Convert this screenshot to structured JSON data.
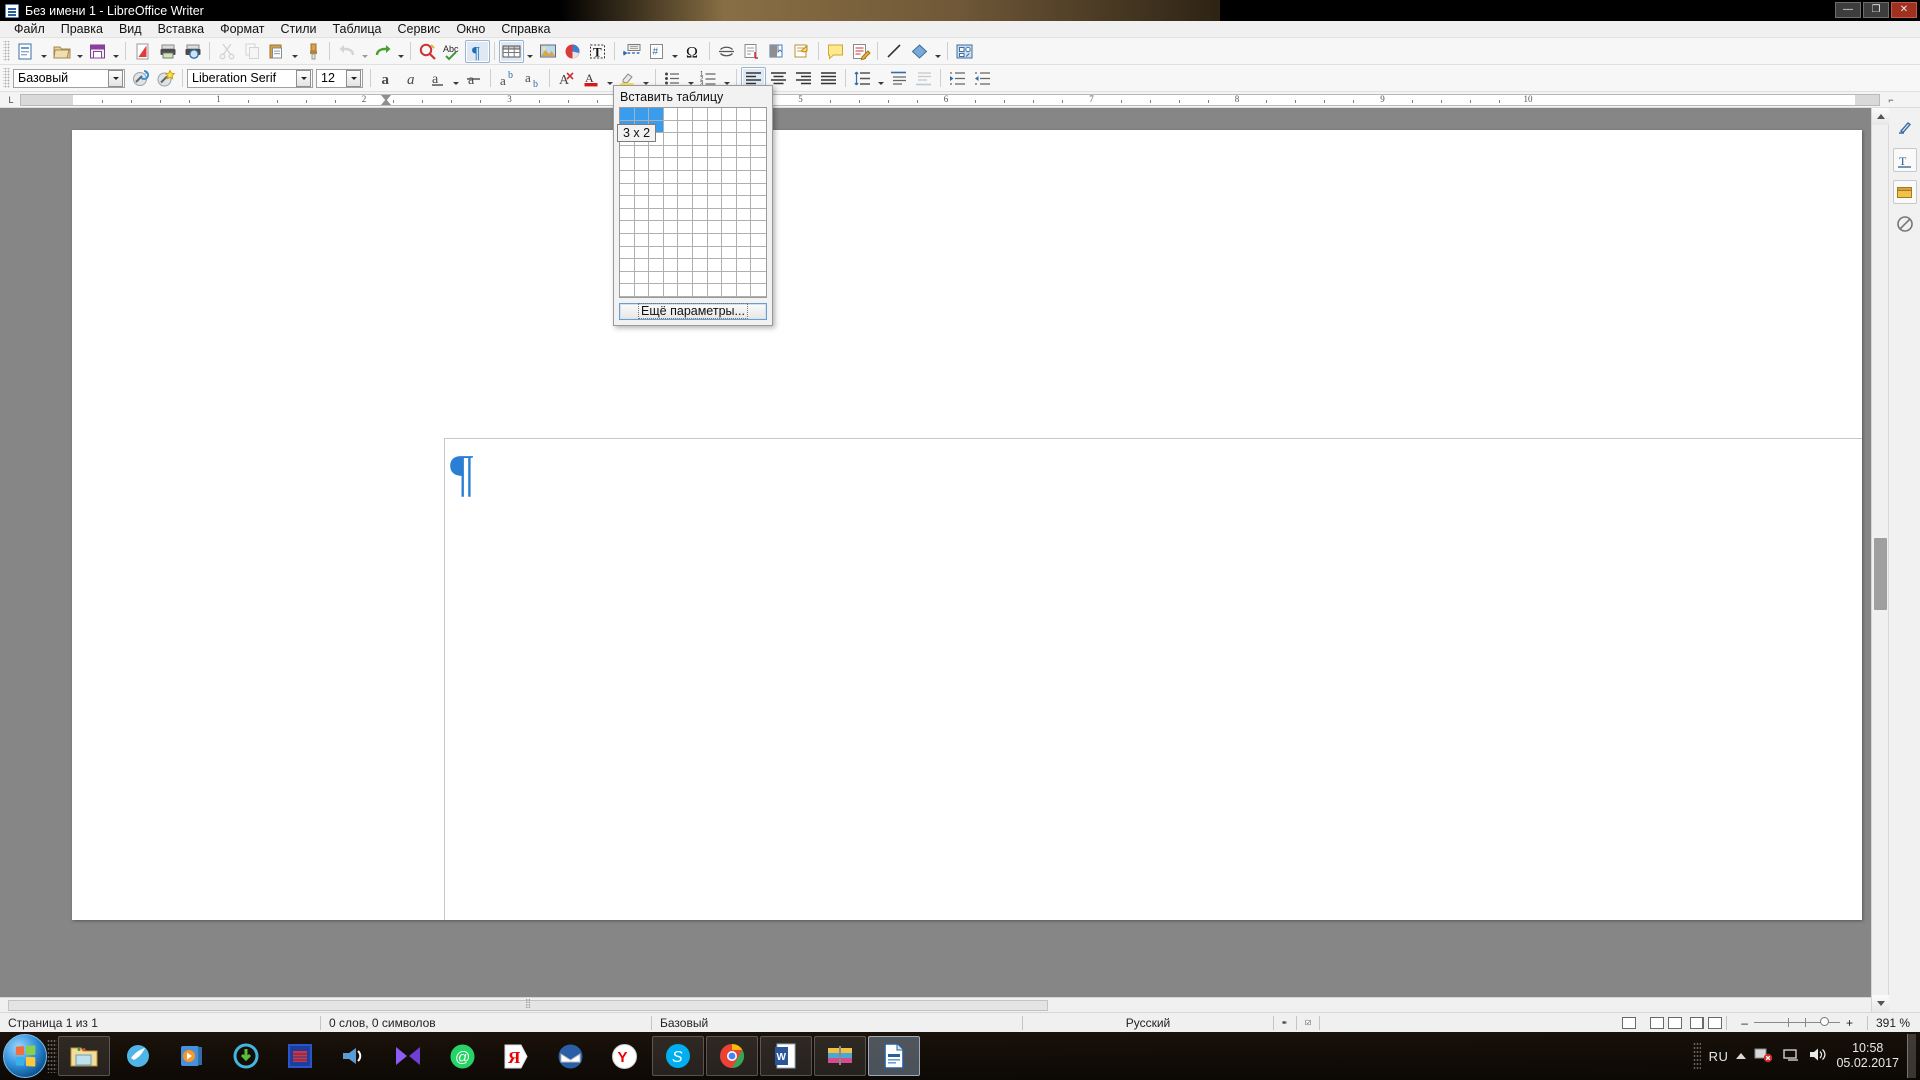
{
  "window": {
    "title": "Без имени 1 - LibreOffice Writer",
    "minimize_label": "—",
    "maximize_label": "❐",
    "close_label": "✕"
  },
  "menubar": {
    "items": [
      {
        "label": "Файл",
        "mnemonic": "Ф"
      },
      {
        "label": "Правка",
        "mnemonic": "П"
      },
      {
        "label": "Вид",
        "mnemonic": "В"
      },
      {
        "label": "Вставка",
        "mnemonic": "а"
      },
      {
        "label": "Формат",
        "mnemonic": "р"
      },
      {
        "label": "Стили",
        "mnemonic": ""
      },
      {
        "label": "Таблица",
        "mnemonic": "Т"
      },
      {
        "label": "Сервис",
        "mnemonic": "е"
      },
      {
        "label": "Окно",
        "mnemonic": "О"
      },
      {
        "label": "Справка",
        "mnemonic": "С"
      }
    ]
  },
  "toolbar_standard": {
    "buttons": [
      {
        "name": "new-document",
        "tooltip": "Создать"
      },
      {
        "name": "open-document",
        "tooltip": "Открыть"
      },
      {
        "name": "save-document",
        "tooltip": "Сохранить"
      },
      {
        "name": "export-pdf",
        "tooltip": "Экспорт в PDF"
      },
      {
        "name": "print",
        "tooltip": "Печать"
      },
      {
        "name": "print-preview",
        "tooltip": "Предварительный просмотр"
      },
      {
        "name": "cut",
        "tooltip": "Вырезать"
      },
      {
        "name": "copy",
        "tooltip": "Копировать"
      },
      {
        "name": "paste",
        "tooltip": "Вставить"
      },
      {
        "name": "clone-formatting",
        "tooltip": "Клонировать форматирование"
      },
      {
        "name": "undo",
        "tooltip": "Отменить"
      },
      {
        "name": "redo",
        "tooltip": "Вернуть"
      },
      {
        "name": "find-replace",
        "tooltip": "Найти и заменить"
      },
      {
        "name": "spelling",
        "tooltip": "Проверка орфографии"
      },
      {
        "name": "formatting-marks",
        "tooltip": "Непечатаемые символы"
      },
      {
        "name": "insert-table",
        "tooltip": "Вставить таблицу"
      },
      {
        "name": "insert-image",
        "tooltip": "Вставить изображение"
      },
      {
        "name": "insert-chart",
        "tooltip": "Вставить диаграмму"
      },
      {
        "name": "insert-text-box",
        "tooltip": "Вставить текстовое поле"
      },
      {
        "name": "insert-page-break",
        "tooltip": "Вставить разрыв страницы"
      },
      {
        "name": "insert-field",
        "tooltip": "Вставить поле"
      },
      {
        "name": "insert-special-character",
        "tooltip": "Вставить специальный символ"
      },
      {
        "name": "insert-footnote",
        "tooltip": "Вставить сноску"
      },
      {
        "name": "insert-endnote",
        "tooltip": "Вставить концевую сноску"
      },
      {
        "name": "insert-bookmark",
        "tooltip": "Вставить закладку"
      },
      {
        "name": "insert-cross-reference",
        "tooltip": "Перекрёстная ссылка"
      },
      {
        "name": "insert-comment",
        "tooltip": "Вставить комментарий"
      },
      {
        "name": "track-changes",
        "tooltip": "Запись изменений"
      },
      {
        "name": "insert-line",
        "tooltip": "Вставить линию"
      },
      {
        "name": "basic-shapes",
        "tooltip": "Основные фигуры"
      },
      {
        "name": "show-draw-functions",
        "tooltip": "Функции рисования"
      }
    ]
  },
  "toolbar_format": {
    "paragraph_style": "Базовый",
    "font_name": "Liberation Serif",
    "font_size": "12",
    "buttons": [
      {
        "name": "update-style",
        "tooltip": "Обновить стиль"
      },
      {
        "name": "new-style",
        "tooltip": "Создать стиль"
      },
      {
        "name": "bold",
        "tooltip": "Жирный"
      },
      {
        "name": "italic",
        "tooltip": "Курсив"
      },
      {
        "name": "underline",
        "tooltip": "Подчёркнутый"
      },
      {
        "name": "strikethrough",
        "tooltip": "Зачёркнутый"
      },
      {
        "name": "superscript",
        "tooltip": "Верхний индекс"
      },
      {
        "name": "subscript",
        "tooltip": "Нижний индекс"
      },
      {
        "name": "clear-formatting",
        "tooltip": "Очистить форматирование"
      },
      {
        "name": "font-color",
        "tooltip": "Цвет шрифта"
      },
      {
        "name": "highlighting-color",
        "tooltip": "Цвет выделения"
      },
      {
        "name": "bullet-list",
        "tooltip": "Маркированный список"
      },
      {
        "name": "number-list",
        "tooltip": "Нумерованный список"
      },
      {
        "name": "align-left",
        "tooltip": "По левому краю"
      },
      {
        "name": "align-center",
        "tooltip": "По центру"
      },
      {
        "name": "align-right",
        "tooltip": "По правому краю"
      },
      {
        "name": "align-justify",
        "tooltip": "По ширине"
      },
      {
        "name": "line-spacing",
        "tooltip": "Межстрочный интервал"
      },
      {
        "name": "paragraph-spacing-above",
        "tooltip": "Интервал сверху"
      },
      {
        "name": "paragraph-spacing-below",
        "tooltip": "Интервал снизу"
      },
      {
        "name": "increase-indent",
        "tooltip": "Увеличить отступ"
      },
      {
        "name": "decrease-indent",
        "tooltip": "Уменьшить отступ"
      }
    ]
  },
  "ruler": {
    "labels": [
      "1",
      "2",
      "3",
      "4",
      "5",
      "6",
      "7",
      "8",
      "9",
      "10"
    ],
    "left_marker": "L",
    "right_marker": "⌐"
  },
  "table_popup": {
    "title": "Вставить таблицу",
    "columns": 10,
    "rows": 15,
    "selected_columns": 3,
    "selected_rows": 2,
    "size_label": "3 x 2",
    "more_button": "Ещё параметры...",
    "more_button_underline": "Е",
    "selection_color": "#3a9cec"
  },
  "document": {
    "paragraph_mark": "¶",
    "paragraph_mark_color": "#2a7fd4"
  },
  "statusbar": {
    "page": "Страница 1 из 1",
    "words": "0 слов, 0 символов",
    "style": "Базовый",
    "language": "Русский",
    "selection_mode": "",
    "save_state": "",
    "zoom": "391 %",
    "zoom_out": "–",
    "zoom_in": "+",
    "view_single": "single-page-view",
    "view_multi": "multi-page-view",
    "view_book": "book-view"
  },
  "taskbar": {
    "start_label": "Пуск",
    "items": [
      {
        "name": "explorer",
        "label": "Проводник",
        "state": "pinned"
      },
      {
        "name": "maxthon-browser",
        "label": "Браузер",
        "state": "normal"
      },
      {
        "name": "media-player",
        "label": "Проигрыватель",
        "state": "normal"
      },
      {
        "name": "downloader",
        "label": "Загрузчик",
        "state": "normal"
      },
      {
        "name": "save-tool",
        "label": "Сохранение",
        "state": "normal"
      },
      {
        "name": "volume-app",
        "label": "Звук",
        "state": "normal"
      },
      {
        "name": "movie-maker",
        "label": "Видеоредактор",
        "state": "normal"
      },
      {
        "name": "whatsapp",
        "label": "Мессенджер",
        "state": "normal"
      },
      {
        "name": "yandex-browser",
        "label": "Яндекс Браузер",
        "state": "normal"
      },
      {
        "name": "thunderbird",
        "label": "Почта",
        "state": "normal"
      },
      {
        "name": "yandex-disk",
        "label": "Яндекс Диск",
        "state": "normal"
      },
      {
        "name": "skype",
        "label": "Skype",
        "state": "pinned"
      },
      {
        "name": "google-chrome",
        "label": "Google Chrome",
        "state": "pinned"
      },
      {
        "name": "ms-word",
        "label": "Microsoft Word",
        "state": "pinned"
      },
      {
        "name": "winrar",
        "label": "WinRAR",
        "state": "pinned"
      },
      {
        "name": "libreoffice-writer",
        "label": "LibreOffice Writer",
        "state": "active"
      }
    ],
    "tray": {
      "language": "RU",
      "time": "10:58",
      "date": "05.02.2017"
    }
  }
}
